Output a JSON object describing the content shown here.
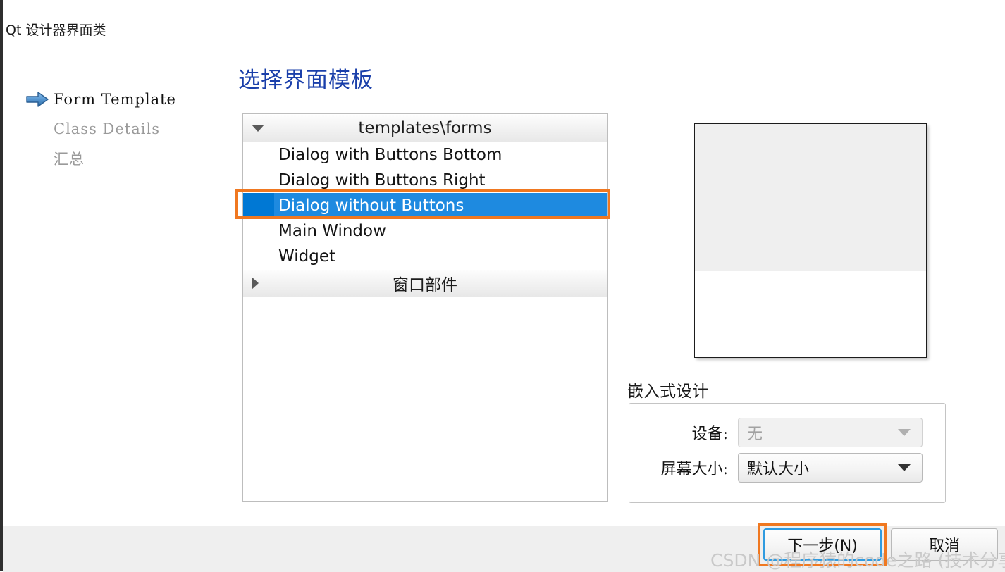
{
  "window": {
    "title": "Qt 设计器界面类"
  },
  "sidebar": {
    "items": [
      {
        "label": "Form Template",
        "state": "active",
        "icon": "arrow-right-icon"
      },
      {
        "label": "Class Details",
        "state": "inactive",
        "icon": ""
      },
      {
        "label": "汇总",
        "state": "inactive",
        "icon": ""
      }
    ]
  },
  "main": {
    "heading": "选择界面模板",
    "template_list": {
      "groups": [
        {
          "header": "templates\\forms",
          "expanded": true,
          "triangle": "chevron-down-icon",
          "items": [
            {
              "label": "Dialog with Buttons Bottom",
              "selected": false
            },
            {
              "label": "Dialog with Buttons Right",
              "selected": false
            },
            {
              "label": "Dialog without Buttons",
              "selected": true
            },
            {
              "label": "Main Window",
              "selected": false
            },
            {
              "label": "Widget",
              "selected": false
            }
          ]
        },
        {
          "header": "窗口部件",
          "expanded": false,
          "triangle": "chevron-right-icon",
          "items": []
        }
      ]
    }
  },
  "preview": {
    "name": "template-preview"
  },
  "embedded_design": {
    "title": "嵌入式设计",
    "fields": [
      {
        "label": "设备:",
        "value": "无",
        "enabled": false
      },
      {
        "label": "屏幕大小:",
        "value": "默认大小",
        "enabled": true
      }
    ]
  },
  "footer": {
    "next_label": "下一步(N)",
    "cancel_label": "取消"
  },
  "watermark": {
    "text": "CSDN @程序猿的code之路 (技术分享)"
  },
  "colors": {
    "heading": "#1a3faa",
    "selection": "#1e8ae0",
    "selection_gutter": "#0078d4",
    "annotation": "#f07820",
    "focus_border": "#2f9be0",
    "bottom_bar": "#efefef"
  }
}
